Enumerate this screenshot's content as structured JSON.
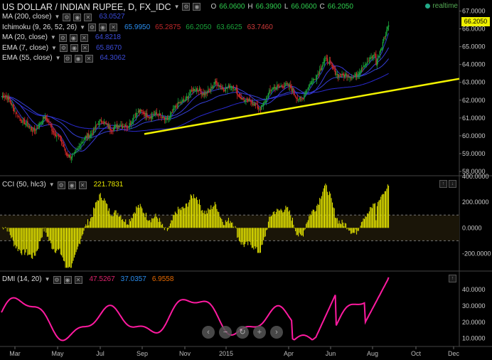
{
  "header": {
    "title": "US DOLLAR / INDIAN RUPEE, D, FX_IDC",
    "ohlc": [
      {
        "k": "O",
        "v": "66.0600"
      },
      {
        "k": "H",
        "v": "66.3900"
      },
      {
        "k": "L",
        "v": "66.0600"
      },
      {
        "k": "C",
        "v": "66.2050"
      }
    ],
    "realtime": "realtime",
    "last_price": "66.2050"
  },
  "indicators": [
    {
      "label": "MA (200, close)",
      "values": [
        "63.0527"
      ],
      "colors": [
        "#3b4bd9"
      ]
    },
    {
      "label": "Ichimoku (9, 26, 52, 26)",
      "values": [
        "65.9950",
        "65.2875",
        "66.2050",
        "63.6625",
        "63.7460"
      ],
      "colors": [
        "#2a8ef0",
        "#c0282a",
        "#1aa23a",
        "#1aa23a",
        "#d03a3a"
      ]
    },
    {
      "label": "MA (20, close)",
      "values": [
        "64.8218"
      ],
      "colors": [
        "#3b4bd9"
      ]
    },
    {
      "label": "EMA (7, close)",
      "values": [
        "65.8670"
      ],
      "colors": [
        "#3b4bd9"
      ]
    },
    {
      "label": "EMA (55, close)",
      "values": [
        "64.3062"
      ],
      "colors": [
        "#3b4bd9"
      ]
    }
  ],
  "cci": {
    "label": "CCI (50, hlc3)",
    "value": "221.7831",
    "color": "#e8e800"
  },
  "dmi": {
    "label": "DMI (14, 20)",
    "values": [
      "47.5267",
      "37.0357",
      "6.9558"
    ],
    "colors": [
      "#e0246e",
      "#2a8ef0",
      "#e86a00"
    ]
  },
  "colors": {
    "trendline": "#f2f200",
    "dmi_line": "#ff1aa0",
    "cci_bars": "#e8e800",
    "up": "#1aa23a",
    "down": "#d02828"
  },
  "chart_data": [
    {
      "type": "candlestick",
      "title": "US DOLLAR / INDIAN RUPEE, D, FX_IDC",
      "ylim": [
        57.8,
        67.3
      ],
      "yticks": [
        "58.0000",
        "59.0000",
        "60.0000",
        "61.0000",
        "62.0000",
        "63.0000",
        "64.0000",
        "65.0000",
        "66.0000",
        "67.0000"
      ],
      "xticks": [
        "Mar",
        "May",
        "Jul",
        "Sep",
        "Nov",
        "2015",
        "Apr",
        "Jun",
        "Aug",
        "Oct",
        "Dec"
      ],
      "close_by_month": [
        {
          "x": "Feb",
          "y": 62.2
        },
        {
          "x": "Mar",
          "y": 60.6
        },
        {
          "x": "Apr",
          "y": 61.0
        },
        {
          "x": "May",
          "y": 58.8
        },
        {
          "x": "Jun",
          "y": 60.2
        },
        {
          "x": "Jul",
          "y": 60.4
        },
        {
          "x": "Aug",
          "y": 61.1
        },
        {
          "x": "Sep",
          "y": 60.9
        },
        {
          "x": "Oct",
          "y": 61.6
        },
        {
          "x": "Nov",
          "y": 62.2
        },
        {
          "x": "Dec",
          "y": 63.2
        },
        {
          "x": "Jan",
          "y": 62.0
        },
        {
          "x": "Feb",
          "y": 62.0
        },
        {
          "x": "Mar",
          "y": 62.6
        },
        {
          "x": "Apr",
          "y": 62.5
        },
        {
          "x": "May",
          "y": 63.8
        },
        {
          "x": "Jun",
          "y": 63.6
        },
        {
          "x": "Jul",
          "y": 63.6
        },
        {
          "x": "Aug",
          "y": 66.2
        }
      ],
      "trendline": [
        {
          "x": "Sep 2014",
          "y": 60.1
        },
        {
          "x": "Oct 2015",
          "y": 63.2
        }
      ]
    },
    {
      "type": "bar",
      "title": "CCI (50, hlc3)",
      "ylim": [
        -330,
        400
      ],
      "yticks": [
        "400.0000",
        "200.0000",
        "0.0000",
        "-200.0000"
      ],
      "levels": [
        100,
        -100
      ],
      "last": 221.7831
    },
    {
      "type": "line",
      "title": "DMI (14, 20)",
      "ylim": [
        5,
        51
      ],
      "yticks": [
        "40.0000",
        "30.0000",
        "20.0000",
        "10.0000"
      ],
      "last": 47.5267
    }
  ]
}
